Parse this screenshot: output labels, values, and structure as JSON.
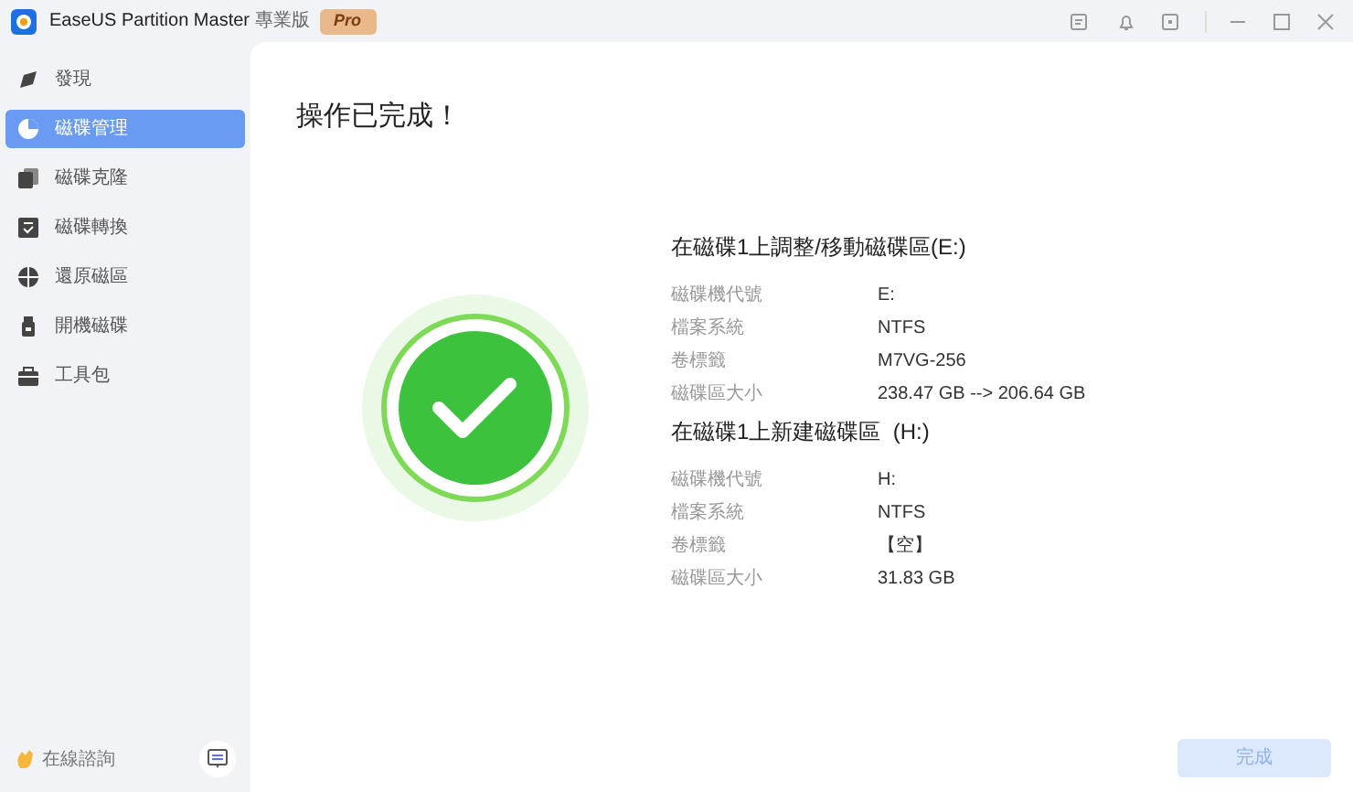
{
  "window": {
    "title": "EaseUS Partition Master",
    "edition": "專業版",
    "badge": "Pro"
  },
  "sidebar": {
    "items": [
      {
        "label": "發現",
        "selected": false
      },
      {
        "label": "磁碟管理",
        "selected": true
      },
      {
        "label": "磁碟克隆",
        "selected": false
      },
      {
        "label": "磁碟轉換",
        "selected": false
      },
      {
        "label": "還原磁區",
        "selected": false
      },
      {
        "label": "開機磁碟",
        "selected": false
      },
      {
        "label": "工具包",
        "selected": false
      }
    ],
    "support": "在線諮詢"
  },
  "main": {
    "heading": "操作已完成！",
    "operations": [
      {
        "title": "在磁碟1上調整/移動磁碟區(E:)",
        "rows": [
          {
            "label": "磁碟機代號",
            "value": "E:"
          },
          {
            "label": "檔案系統",
            "value": "NTFS"
          },
          {
            "label": "卷標籤",
            "value": "M7VG-256"
          },
          {
            "label": "磁碟區大小",
            "value": "238.47 GB --> 206.64 GB"
          }
        ]
      },
      {
        "title": "在磁碟1上新建磁碟區  (H:)",
        "rows": [
          {
            "label": "磁碟機代號",
            "value": "H:"
          },
          {
            "label": "檔案系統",
            "value": "NTFS"
          },
          {
            "label": "卷標籤",
            "value": "【空】"
          },
          {
            "label": "磁碟區大小",
            "value": "31.83 GB"
          }
        ]
      }
    ],
    "finish_button": {
      "label": "完成",
      "disabled": true
    }
  }
}
